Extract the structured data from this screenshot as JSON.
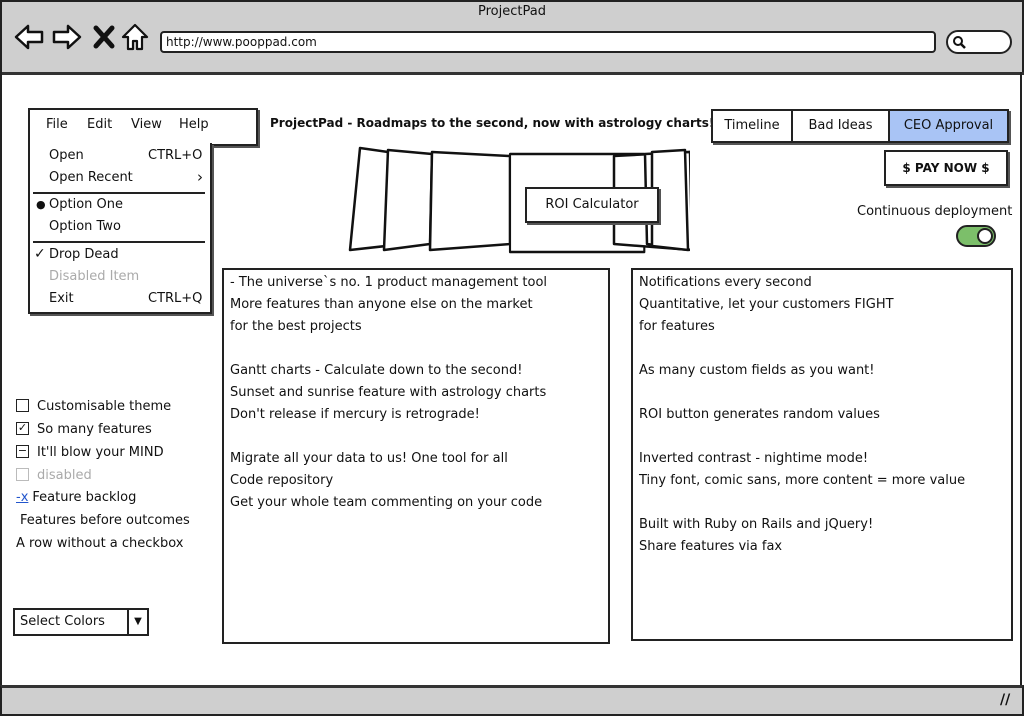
{
  "window": {
    "title": "ProjectPad",
    "url": "http://www.pooppad.com"
  },
  "menu": {
    "top_items": [
      "File",
      "Edit",
      "View",
      "Help"
    ],
    "open": {
      "label": "Open",
      "shortcut": "CTRL+O"
    },
    "open_recent": {
      "label": "Open Recent",
      "arrow": "›"
    },
    "option_one": {
      "label": "Option One",
      "mark": "●"
    },
    "option_two": {
      "label": "Option Two"
    },
    "drop_dead": {
      "label": "Drop Dead",
      "mark": "✓"
    },
    "disabled_item": {
      "label": "Disabled Item"
    },
    "exit": {
      "label": "Exit",
      "shortcut": "CTRL+Q"
    }
  },
  "header": {
    "title": "ProjectPad - Roadmaps to the second, now with astrology charts!",
    "tabs": [
      "Timeline",
      "Bad Ideas",
      "CEO Approval"
    ],
    "active_tab": "CEO Approval",
    "pay_button": "$ PAY NOW $",
    "cd_label": "Continuous deployment",
    "cd_enabled": true
  },
  "carousel": {
    "center_button": "ROI Calculator"
  },
  "left_panel_lines": [
    "- The universe`s no. 1 product management tool",
    "More features than anyone else on the market",
    "for the best projects",
    "",
    "Gantt charts - Calculate down to the second!",
    "Sunset and sunrise feature with astrology charts",
    "Don't release if mercury is retrograde!",
    "",
    "Migrate all your data to us! One tool for all",
    "Code repository",
    "Get your whole team commenting on your code"
  ],
  "right_panel_lines": [
    "Notifications every second",
    "Quantitative, let your customers FIGHT",
    "for features",
    "",
    "As many custom fields as you want!",
    "",
    "ROI button generates random values",
    "",
    "Inverted contrast - nightime mode!",
    "Tiny font, comic sans, more content  = more value",
    "",
    "Built with Ruby on Rails and jQuery!",
    "Share features via fax"
  ],
  "checklist": {
    "customisable": {
      "label": "Customisable theme",
      "state": "unchecked"
    },
    "so_many": {
      "label": "So many features",
      "state": "checked",
      "mark": "✓"
    },
    "blow_mind": {
      "label": "It'll blow your MIND",
      "state": "indeterminate",
      "mark": "−"
    },
    "disabled": {
      "label": "disabled",
      "state": "disabled"
    },
    "backlog": {
      "prefix": "-x",
      "label": "Feature backlog"
    },
    "features_before": {
      "label": "Features before outcomes"
    },
    "no_checkbox": {
      "label": "A row without a checkbox"
    }
  },
  "select": {
    "value": "Select Colors",
    "arrow": "▼"
  },
  "colors": {
    "chrome": "#cfcfcf",
    "active_tab": "#a9c4f5",
    "toggle_on": "#7cbf6a"
  }
}
